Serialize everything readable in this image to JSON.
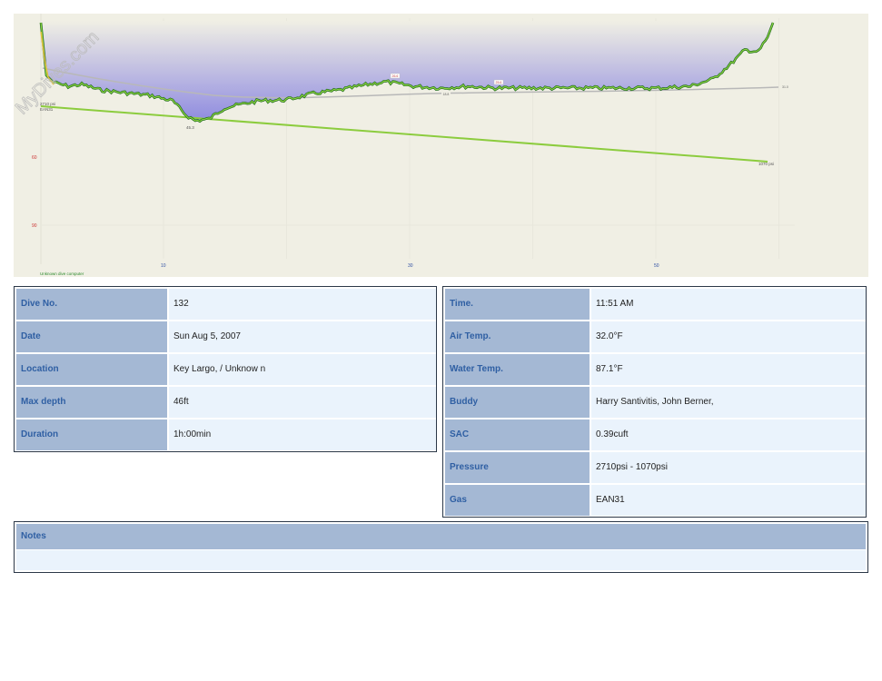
{
  "watermark": "MyDives.com",
  "profile": {
    "computer_label": "Unknown dive computer",
    "start_pressure_label": "2710 psi",
    "gas_label": "EAN31",
    "end_pressure_label": "1070 psi",
    "max_depth_marker": "45.3",
    "depth_axis_labels": [
      "60",
      "90"
    ],
    "time_axis_labels": [
      "10",
      "30",
      "50"
    ],
    "marker_labels": [
      "26.6",
      "18.8",
      "25.6"
    ],
    "temp_label": "31.0",
    "colors": {
      "background": "#f0efe4",
      "depth_fill": "#8f8be0",
      "depth_line_dark": "#1e6a1e",
      "depth_line_light": "#8ad23e",
      "pressure_line": "#8ccc3e",
      "temperature_line": "#b8b8b8",
      "axis_red": "#cc3333"
    }
  },
  "left_table": {
    "rows": [
      {
        "label": "Dive No.",
        "value": "132"
      },
      {
        "label": "Date",
        "value": "Sun Aug 5, 2007"
      },
      {
        "label": "Location",
        "value": "Key Largo, / Unknow n"
      },
      {
        "label": "Max depth",
        "value": "46ft"
      },
      {
        "label": "Duration",
        "value": "1h:00min"
      }
    ]
  },
  "right_table": {
    "rows": [
      {
        "label": "Time.",
        "value": "11:51 AM"
      },
      {
        "label": "Air Temp.",
        "value": "32.0°F"
      },
      {
        "label": "Water Temp.",
        "value": "87.1°F"
      },
      {
        "label": "Buddy",
        "value": "Harry Santivitis, John Berner,"
      },
      {
        "label": "SAC",
        "value": "0.39cuft"
      },
      {
        "label": "Pressure",
        "value": "2710psi - 1070psi"
      },
      {
        "label": "Gas",
        "value": "EAN31"
      }
    ]
  },
  "notes": {
    "label": "Notes",
    "text": ""
  }
}
